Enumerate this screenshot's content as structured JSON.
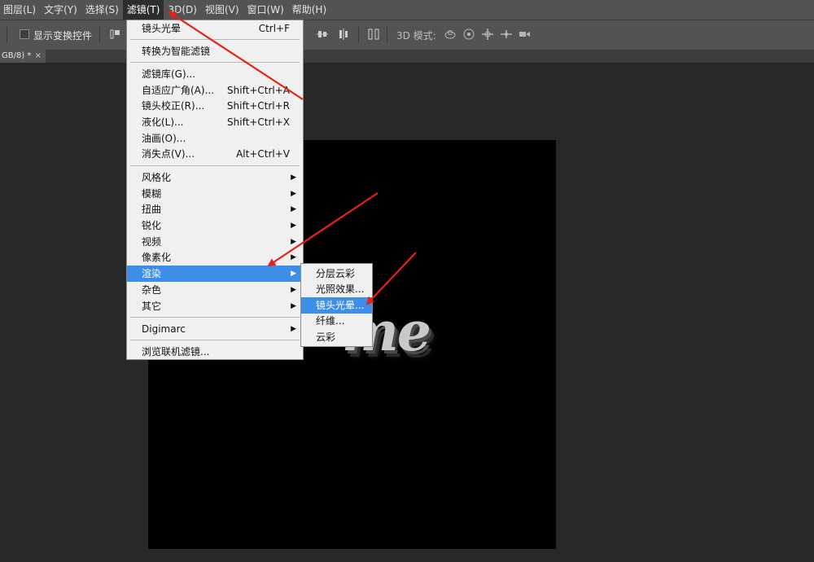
{
  "menubar": {
    "items": [
      {
        "label": "图层(L)"
      },
      {
        "label": "文字(Y)"
      },
      {
        "label": "选择(S)"
      },
      {
        "label": "滤镜(T)"
      },
      {
        "label": "3D(D)"
      },
      {
        "label": "视图(V)"
      },
      {
        "label": "窗口(W)"
      },
      {
        "label": "帮助(H)"
      }
    ]
  },
  "options_bar": {
    "show_transform_label": "显示变换控件",
    "show_transform_checked": false,
    "mode3d_label": "3D 模式:"
  },
  "document_tab": {
    "label": "GB/8) *",
    "close": "×"
  },
  "canvas_text": "me",
  "filter_menu": {
    "items": [
      {
        "label": "镜头光晕",
        "shortcut": "Ctrl+F"
      },
      {
        "label": "转换为智能滤镜"
      },
      {
        "label": "滤镜库(G)..."
      },
      {
        "label": "自适应广角(A)...",
        "shortcut": "Shift+Ctrl+A"
      },
      {
        "label": "镜头校正(R)...",
        "shortcut": "Shift+Ctrl+R"
      },
      {
        "label": "液化(L)...",
        "shortcut": "Shift+Ctrl+X"
      },
      {
        "label": "油画(O)..."
      },
      {
        "label": "消失点(V)...",
        "shortcut": "Alt+Ctrl+V"
      },
      {
        "label": "风格化",
        "submenu": true
      },
      {
        "label": "模糊",
        "submenu": true
      },
      {
        "label": "扭曲",
        "submenu": true
      },
      {
        "label": "锐化",
        "submenu": true
      },
      {
        "label": "视频",
        "submenu": true
      },
      {
        "label": "像素化",
        "submenu": true
      },
      {
        "label": "渲染",
        "submenu": true,
        "highlighted": true
      },
      {
        "label": "杂色",
        "submenu": true
      },
      {
        "label": "其它",
        "submenu": true
      },
      {
        "label": "Digimarc",
        "submenu": true
      },
      {
        "label": "浏览联机滤镜..."
      }
    ]
  },
  "render_submenu": {
    "items": [
      {
        "label": "分层云彩"
      },
      {
        "label": "光照效果..."
      },
      {
        "label": "镜头光晕...",
        "highlighted": true
      },
      {
        "label": "纤维..."
      },
      {
        "label": "云彩"
      }
    ]
  },
  "submenu_arrow": "▶",
  "colors": {
    "chrome": "#535353",
    "workspace": "#282828",
    "menu_bg": "#f0f0f0",
    "highlight": "#3d8ee9",
    "annotation": "#e8201c"
  }
}
